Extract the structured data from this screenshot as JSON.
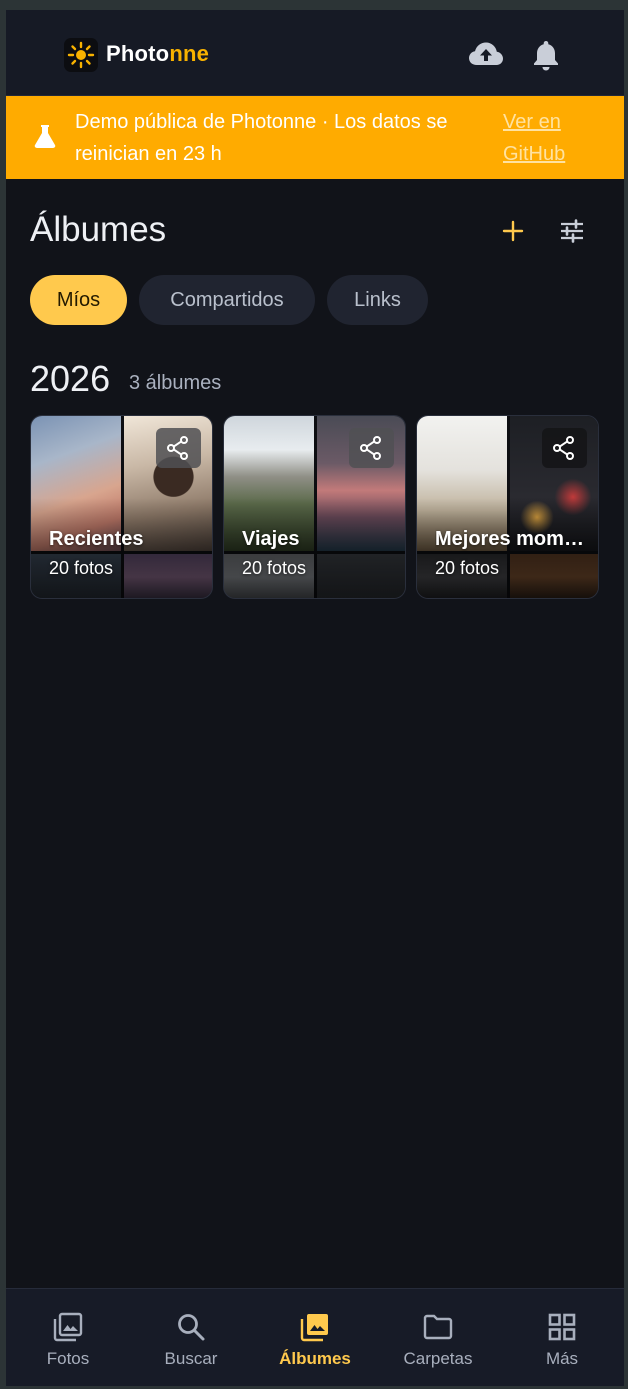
{
  "header": {
    "brand_part1": "Photo",
    "brand_part2": "nne",
    "icons": [
      "photonne-logo-icon",
      "cloud-upload-icon",
      "bell-icon"
    ]
  },
  "banner": {
    "text": "Demo pública de Photonne · Los datos se reinician en 23 h",
    "link": "Ver en GitHub",
    "icon": "flask-icon"
  },
  "page": {
    "title": "Álbumes",
    "actions": [
      "add-icon",
      "tune-icon"
    ]
  },
  "tabs": [
    {
      "label": "Míos",
      "active": true
    },
    {
      "label": "Compartidos",
      "active": false
    },
    {
      "label": "Links",
      "active": false
    }
  ],
  "section": {
    "year": "2026",
    "count": "3 álbumes"
  },
  "albums": [
    {
      "name": "Recientes",
      "count": "20 fotos",
      "shared": true
    },
    {
      "name": "Viajes",
      "count": "20 fotos",
      "shared": true
    },
    {
      "name": "Mejores momentos",
      "count": "20 fotos",
      "shared": true
    }
  ],
  "nav": [
    {
      "label": "Fotos",
      "icon": "photo-library-icon",
      "active": false
    },
    {
      "label": "Buscar",
      "icon": "search-icon",
      "active": false
    },
    {
      "label": "Álbumes",
      "icon": "photo-album-icon",
      "active": true
    },
    {
      "label": "Carpetas",
      "icon": "folder-icon",
      "active": false
    },
    {
      "label": "Más",
      "icon": "grid-icon",
      "active": false
    }
  ],
  "colors": {
    "accent": "#ffc94d",
    "banner": "#ffab00",
    "background": "#111319"
  }
}
